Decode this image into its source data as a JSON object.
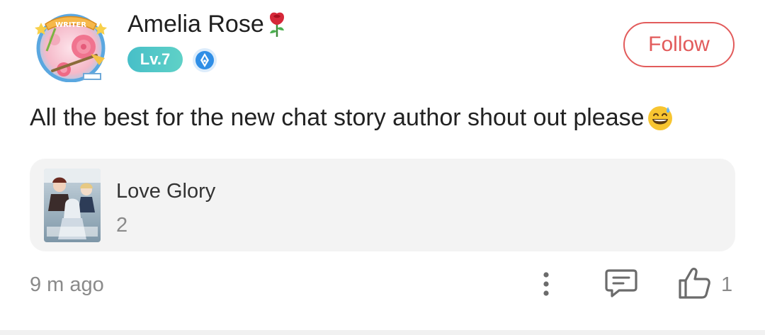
{
  "author": {
    "name": "Amelia Rose",
    "level": "Lv.7",
    "avatar_badge_text": "WRITER"
  },
  "follow_button": {
    "label": "Follow"
  },
  "post": {
    "text": "All the best for the new chat story author shout out please"
  },
  "story_card": {
    "title": "Love Glory",
    "count": "2"
  },
  "footer": {
    "time_ago": "9 m ago",
    "like_count": "1"
  },
  "icons": {
    "more": "more-vertical-icon",
    "comment": "comment-icon",
    "like": "thumbs-up-icon",
    "verified": "pen-nib-badge-icon",
    "emoji": "grinning-sweat-emoji"
  },
  "colors": {
    "accent": "#e25b5b",
    "level_badge": "#4cc3c7",
    "verified_badge": "#2f8ee6",
    "muted_text": "#8a8a8a",
    "card_bg": "#f3f3f3"
  }
}
